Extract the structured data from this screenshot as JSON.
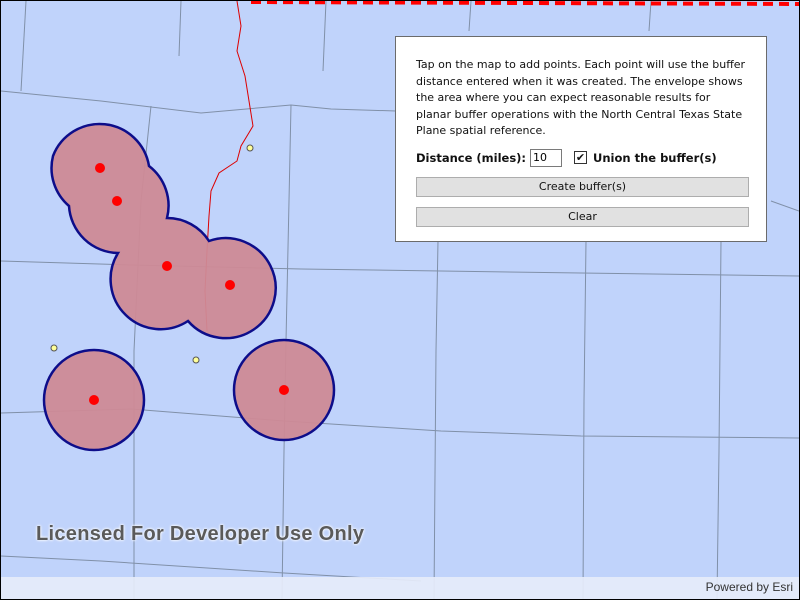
{
  "panel": {
    "instructions": "Tap on the map to add points. Each point will use the buffer distance entered when it was created. The envelope shows the area where you can expect reasonable results for planar buffer operations with the North Central Texas State Plane spatial reference.",
    "distance_label": "Distance (miles):",
    "distance_value": "10",
    "union_label": "Union the buffer(s)",
    "union_checked": true,
    "create_label": "Create buffer(s)",
    "clear_label": "Clear"
  },
  "map": {
    "license_text": "Licensed For Developer Use Only",
    "attribution": "Powered by Esri",
    "colors": {
      "background": "#c0d3fb",
      "buffer_fill": "#cd8a96",
      "buffer_outline": "#0d0d8a",
      "point": "#ff0000",
      "envelope": "#ff0000",
      "river": "#dd0000",
      "city_marker": "#ffff99"
    }
  }
}
